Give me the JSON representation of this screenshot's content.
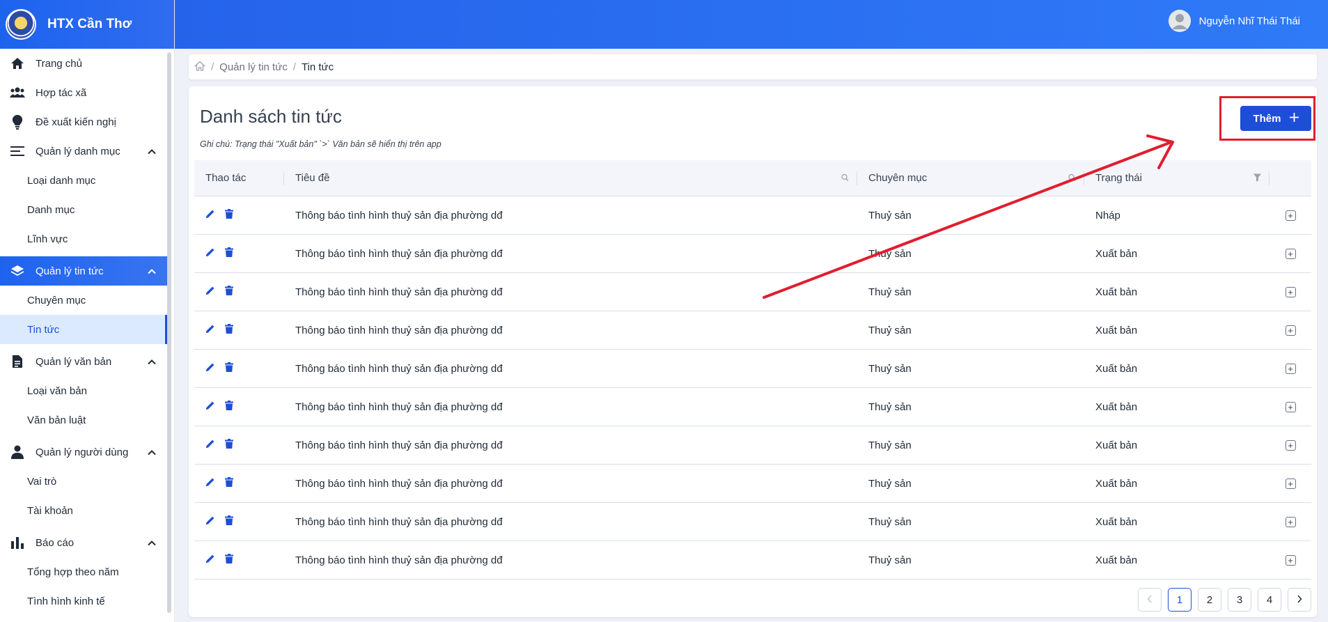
{
  "brand": {
    "title": "HTX Cần Thơ"
  },
  "header": {
    "user_name": "Nguyễn Nhĩ Thái Thái"
  },
  "sidebar": {
    "home": "Trang chủ",
    "cooperative": "Hợp tác xã",
    "proposal": "Đề xuất kiến nghị",
    "category_group": "Quản lý danh mục",
    "category_type": "Loại danh mục",
    "category": "Danh mục",
    "field": "Lĩnh vực",
    "news_group": "Quản lý tin tức",
    "news_topic": "Chuyên mục",
    "news": "Tin tức",
    "docs_group": "Quản lý văn bản",
    "doc_type": "Loại văn bản",
    "legal_doc": "Văn bản luật",
    "users_group": "Quản lý người dùng",
    "role": "Vai trò",
    "account": "Tài khoản",
    "report_group": "Báo cáo",
    "annual_summary": "Tổng hợp theo năm",
    "economic_status": "Tình hình kinh tế"
  },
  "breadcrumb": {
    "parent": "Quản lý tin tức",
    "current": "Tin tức"
  },
  "main": {
    "title": "Danh sách tin tức",
    "note": "Ghi chú: Trạng thái \"Xuất bản\" `>` Văn bản sẽ hiển thị trên app",
    "add_label": "Thêm"
  },
  "table": {
    "columns": {
      "actions": "Thao tác",
      "title": "Tiêu đề",
      "topic": "Chuyên mục",
      "status": "Trạng thái"
    },
    "rows": [
      {
        "title": "Thông báo tình hình thuỷ sản địa phường dđ",
        "topic": "Thuỷ sản",
        "status": "Nháp"
      },
      {
        "title": "Thông báo tình hình thuỷ sản địa phường dđ",
        "topic": "Thuỷ sản",
        "status": "Xuất bản"
      },
      {
        "title": "Thông báo tình hình thuỷ sản địa phường dđ",
        "topic": "Thuỷ sản",
        "status": "Xuất bản"
      },
      {
        "title": "Thông báo tình hình thuỷ sản địa phường dđ",
        "topic": "Thuỷ sản",
        "status": "Xuất bản"
      },
      {
        "title": "Thông báo tình hình thuỷ sản địa phường dđ",
        "topic": "Thuỷ sản",
        "status": "Xuất bản"
      },
      {
        "title": "Thông báo tình hình thuỷ sản địa phường dđ",
        "topic": "Thuỷ sản",
        "status": "Xuất bản"
      },
      {
        "title": "Thông báo tình hình thuỷ sản địa phường dđ",
        "topic": "Thuỷ sản",
        "status": "Xuất bản"
      },
      {
        "title": "Thông báo tình hình thuỷ sản địa phường dđ",
        "topic": "Thuỷ sản",
        "status": "Xuất bản"
      },
      {
        "title": "Thông báo tình hình thuỷ sản địa phường dđ",
        "topic": "Thuỷ sản",
        "status": "Xuất bản"
      },
      {
        "title": "Thông báo tình hình thuỷ sản địa phường dđ",
        "topic": "Thuỷ sản",
        "status": "Xuất bản"
      }
    ]
  },
  "pagination": {
    "pages": [
      "1",
      "2",
      "3",
      "4"
    ],
    "current": "1"
  },
  "colors": {
    "primary": "#1d4ed8",
    "annotation": "#e11d2e"
  },
  "icons": [
    "home-icon",
    "users-icon",
    "lightbulb-icon",
    "list-icon",
    "layers-icon",
    "document-icon",
    "user-icon",
    "bar-chart-icon",
    "edit-icon",
    "trash-icon",
    "search-icon",
    "filter-icon",
    "plus-icon",
    "chevron-left-icon",
    "chevron-right-icon"
  ]
}
